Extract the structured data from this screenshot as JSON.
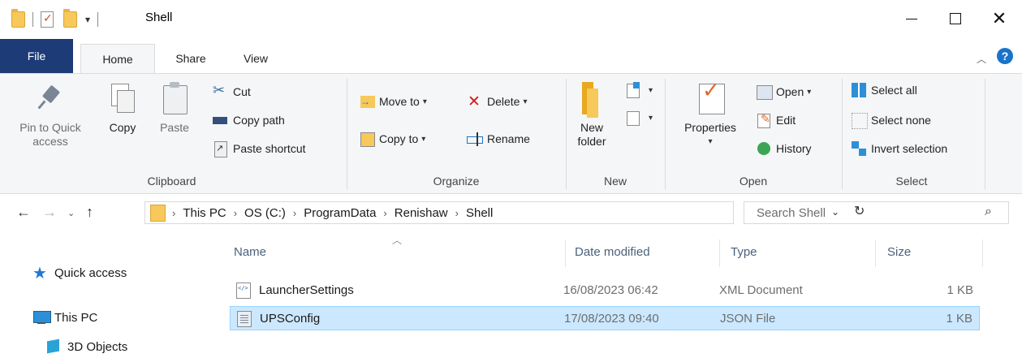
{
  "window": {
    "title": "Shell"
  },
  "ribbon_tabs": {
    "file": "File",
    "home": "Home",
    "share": "Share",
    "view": "View"
  },
  "ribbon": {
    "clipboard": {
      "pin_label_1": "Pin to Quick",
      "pin_label_2": "access",
      "copy": "Copy",
      "paste": "Paste",
      "cut": "Cut",
      "copy_path": "Copy path",
      "paste_shortcut": "Paste shortcut",
      "group": "Clipboard"
    },
    "organize": {
      "move_to": "Move to",
      "copy_to": "Copy to",
      "delete": "Delete",
      "rename": "Rename",
      "group": "Organize"
    },
    "new": {
      "new_folder_1": "New",
      "new_folder_2": "folder",
      "group": "New"
    },
    "open": {
      "properties": "Properties",
      "open": "Open",
      "edit": "Edit",
      "history": "History",
      "group": "Open"
    },
    "select": {
      "select_all": "Select all",
      "select_none": "Select none",
      "invert_selection": "Invert selection",
      "group": "Select"
    }
  },
  "address": {
    "breadcrumbs": [
      "This PC",
      "OS (C:)",
      "ProgramData",
      "Renishaw",
      "Shell"
    ]
  },
  "search": {
    "placeholder": "Search Shell"
  },
  "navigation": {
    "quick_access": "Quick access",
    "this_pc": "This PC",
    "objects_3d": "3D Objects"
  },
  "columns": {
    "name": "Name",
    "date_modified": "Date modified",
    "type": "Type",
    "size": "Size"
  },
  "files": [
    {
      "name": "LauncherSettings",
      "date": "16/08/2023 06:42",
      "type": "XML Document",
      "size": "1 KB",
      "icon": "xml-file-icon",
      "selected": false
    },
    {
      "name": "UPSConfig",
      "date": "17/08/2023 09:40",
      "type": "JSON File",
      "size": "1 KB",
      "icon": "json-file-icon",
      "selected": true
    }
  ],
  "colors": {
    "file_tab": "#1d3b77",
    "selection": "#cce8ff",
    "accent": "#1a73c8"
  }
}
